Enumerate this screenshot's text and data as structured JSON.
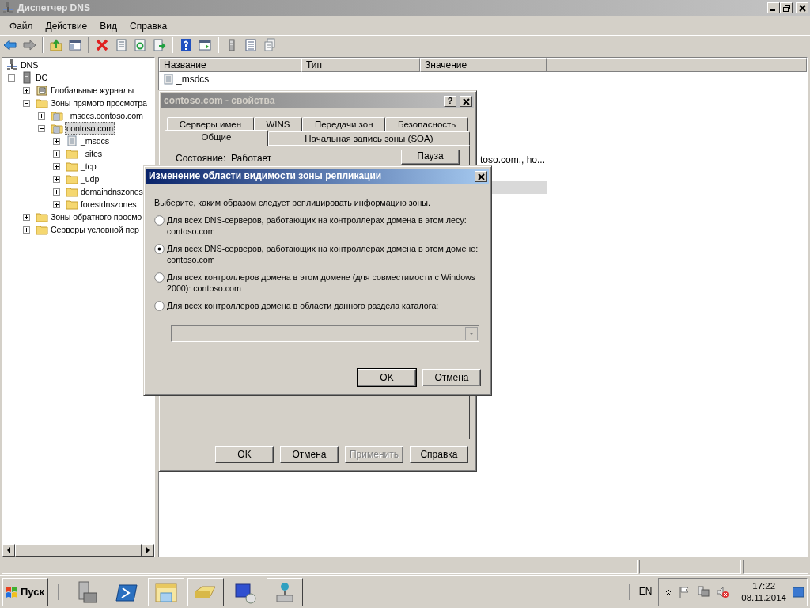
{
  "window": {
    "title": "Диспетчер DNS"
  },
  "menu": [
    "Файл",
    "Действие",
    "Вид",
    "Справка"
  ],
  "tree": [
    {
      "label": "DNS",
      "kind": "dns",
      "selected": false,
      "children": [
        {
          "label": "DC",
          "kind": "server",
          "expanded": true,
          "selected": false,
          "children": [
            {
              "label": "Глобальные журналы",
              "kind": "journal",
              "expanded": false,
              "selected": false
            },
            {
              "label": "Зоны прямого просмотра",
              "kind": "folder",
              "expanded": true,
              "selected": false,
              "children": [
                {
                  "label": "_msdcs.contoso.com",
                  "kind": "zone",
                  "expanded": false,
                  "selected": false
                },
                {
                  "label": "contoso.com",
                  "kind": "zone",
                  "expanded": true,
                  "selected": true,
                  "children": [
                    {
                      "label": "_msdcs",
                      "kind": "delegation",
                      "expanded": false,
                      "selected": false
                    },
                    {
                      "label": "_sites",
                      "kind": "folder",
                      "expanded": false,
                      "selected": false
                    },
                    {
                      "label": "_tcp",
                      "kind": "folder",
                      "expanded": false,
                      "selected": false
                    },
                    {
                      "label": "_udp",
                      "kind": "folder",
                      "expanded": false,
                      "selected": false
                    },
                    {
                      "label": "domaindnszones",
                      "kind": "folder",
                      "expanded": false,
                      "selected": false
                    },
                    {
                      "label": "forestdnszones",
                      "kind": "folder",
                      "expanded": false,
                      "selected": false
                    }
                  ]
                }
              ]
            },
            {
              "label": "Зоны обратного просмо",
              "kind": "folder",
              "expanded": false,
              "selected": false
            },
            {
              "label": "Серверы условной пер",
              "kind": "folder",
              "expanded": false,
              "selected": false
            }
          ]
        }
      ]
    }
  ],
  "list": {
    "columns": [
      "Название",
      "Тип",
      "Значение"
    ],
    "rows": [
      {
        "name": "_msdcs",
        "kind": "delegation",
        "selected": false
      },
      {
        "value": "toso.com., ho...",
        "selected": false
      },
      {
        "selected": true
      }
    ]
  },
  "properties_dialog": {
    "title": "contoso.com - свойства",
    "help": "?",
    "tab_rows": [
      [
        {
          "label": "Серверы имен",
          "selected": false
        },
        {
          "label": "WINS",
          "selected": false
        },
        {
          "label": "Передачи зон",
          "selected": false
        },
        {
          "label": "Безопасность",
          "selected": false
        }
      ],
      [
        {
          "label": "Общие",
          "selected": true
        },
        {
          "label": "Начальная запись зоны (SOA)",
          "selected": false
        }
      ]
    ],
    "status_label": "Состояние:",
    "status_value": "Работает",
    "pause_button": "Пауза",
    "buttons": [
      {
        "label": "OK",
        "disabled": false
      },
      {
        "label": "Отмена",
        "disabled": false
      },
      {
        "label": "Применить",
        "disabled": true
      },
      {
        "label": "Справка",
        "disabled": false
      }
    ]
  },
  "replication_dialog": {
    "title": "Изменение области видимости зоны репликации",
    "prompt": "Выберите, каким образом следует реплицировать информацию зоны.",
    "options": [
      {
        "label": "Для всех DNS-серверов, работающих на контроллерах домена в этом лесу: contoso.com",
        "selected": false
      },
      {
        "label": "Для всех DNS-серверов, работающих на контроллерах домена в этом домене: contoso.com",
        "selected": true
      },
      {
        "label": "Для всех контроллеров домена в этом домене (для совместимости с Windows 2000): contoso.com",
        "selected": false
      },
      {
        "label": "Для всех контроллеров домена в области данного раздела каталога:",
        "selected": false
      }
    ],
    "partition_combo": {
      "disabled": true
    },
    "buttons": [
      {
        "label": "OK",
        "default": true
      },
      {
        "label": "Отмена",
        "default": false
      }
    ]
  },
  "taskbar": {
    "start": "Пуск",
    "apps": [
      {
        "kind": "server",
        "running": false
      },
      {
        "kind": "powershell",
        "running": false
      },
      {
        "kind": "explorer",
        "running": true
      },
      {
        "kind": "folder",
        "running": true
      },
      {
        "kind": "remote",
        "running": false
      },
      {
        "kind": "network",
        "running": true
      }
    ],
    "language": "EN",
    "time": "17:22",
    "date": "08.11.2014"
  }
}
